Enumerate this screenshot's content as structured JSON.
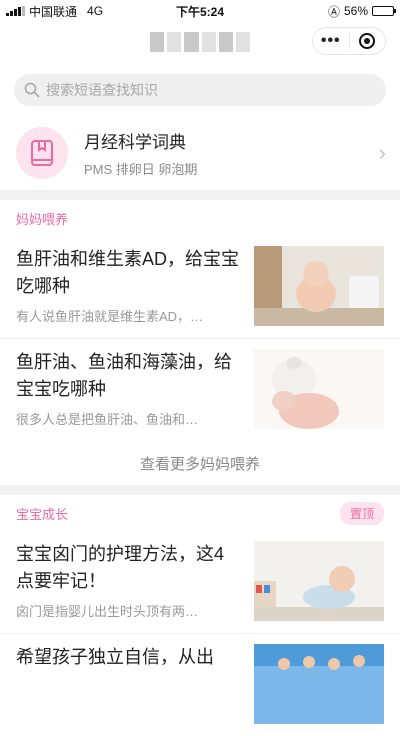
{
  "status_bar": {
    "carrier": "中国联通",
    "network": "4G",
    "time": "下午5:24",
    "battery": "56%",
    "battery_level": 0.56
  },
  "nav": {
    "more_icon": "more-dots-icon",
    "close_icon": "target-icon"
  },
  "search": {
    "placeholder": "搜索短语查找知识",
    "icon": "search-icon"
  },
  "dictionary": {
    "title": "月经科学词典",
    "subtitle": "PMS 排卵日 卵泡期",
    "icon": "book-icon",
    "accent": "#ec6aa4",
    "bg": "#fde3ee"
  },
  "sections": [
    {
      "title": "妈妈喂养",
      "articles": [
        {
          "title": "鱼肝油和维生素AD，给宝宝吃哪种",
          "desc": "有人说鱼肝油就是维生素AD，…"
        },
        {
          "title": "鱼肝油、鱼油和海藻油，给宝宝吃哪种",
          "desc": "很多人总是把鱼肝油、鱼油和…"
        }
      ],
      "more": "查看更多妈妈喂养"
    },
    {
      "title": "宝宝成长",
      "badge": "置顶",
      "articles": [
        {
          "title": "宝宝囟门的护理方法，这4点要牢记！",
          "desc": "囟门是指婴儿出生时头顶有两…"
        },
        {
          "title": "希望孩子独立自信，从出",
          "desc": ""
        }
      ]
    }
  ]
}
